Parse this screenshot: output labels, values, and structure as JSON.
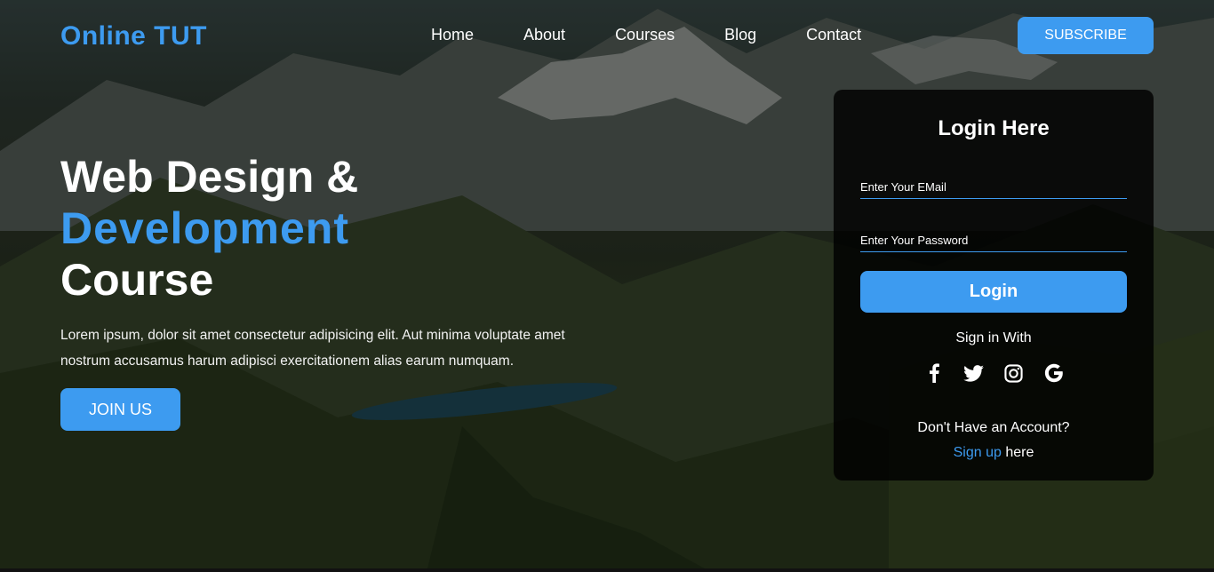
{
  "header": {
    "logo": "Online TUT",
    "nav": [
      "Home",
      "About",
      "Courses",
      "Blog",
      "Contact"
    ],
    "subscribe_label": "SUBSCRIBE"
  },
  "hero": {
    "title_line1": "Web Design &",
    "title_line2": "Development",
    "title_line3": "Course",
    "paragraph": "Lorem ipsum, dolor sit amet consectetur adipisicing elit. Aut minima voluptate amet nostrum accusamus harum adipisci exercitationem alias earum numquam.",
    "join_label": "JOIN US"
  },
  "login": {
    "title": "Login Here",
    "email_placeholder": "Enter Your EMail",
    "password_placeholder": "Enter Your Password",
    "button_label": "Login",
    "signin_with": "Sign in With",
    "social_icons": [
      "facebook-icon",
      "twitter-icon",
      "instagram-icon",
      "google-icon"
    ],
    "no_account": "Don't Have an Account?",
    "signup_link": "Sign up",
    "signup_suffix": " here"
  },
  "colors": {
    "accent": "#3d9bf0",
    "card_bg": "#000000",
    "text": "#ffffff"
  }
}
